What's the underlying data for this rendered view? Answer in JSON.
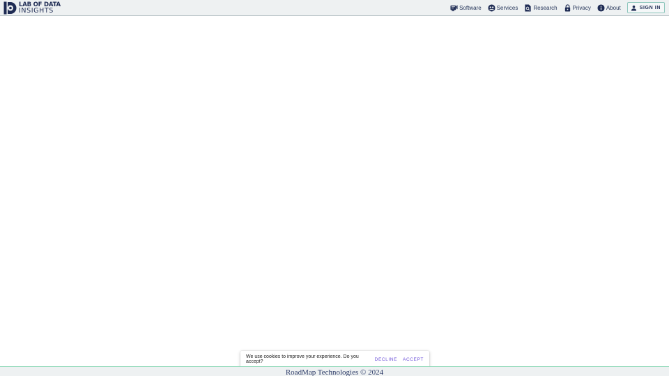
{
  "brand": {
    "line1": "LAB OF DATA",
    "line2": "INSIGHTS",
    "logo_icon": "lab-of-data-insights-logo",
    "color": "#1f2c54"
  },
  "nav": {
    "items": [
      {
        "label": "Software",
        "icon": "software-icon"
      },
      {
        "label": "Services",
        "icon": "services-icon"
      },
      {
        "label": "Research",
        "icon": "research-icon"
      },
      {
        "label": "Privacy",
        "icon": "lock-icon"
      },
      {
        "label": "About",
        "icon": "info-icon"
      }
    ],
    "signin_label": "SIGN IN",
    "signin_icon": "person-icon"
  },
  "cookie_banner": {
    "message": "We use cookies to improve your experience. Do you accept?",
    "decline_label": "DECLINE",
    "accept_label": "ACCEPT",
    "button_color": "#6b4fd8"
  },
  "footer": {
    "text": "RoadMap Technologies © 2024"
  },
  "colors": {
    "topbar_bg": "#eef1f2",
    "accent_border": "#8fd9b8"
  }
}
